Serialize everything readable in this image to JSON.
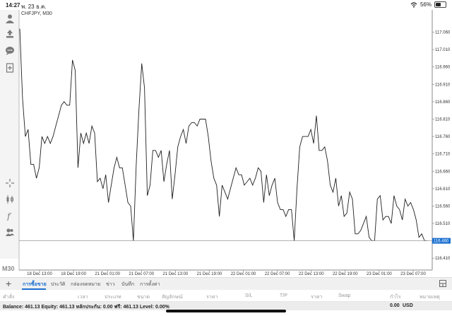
{
  "status_bar": {
    "time": "14:27",
    "date": "พ. 23 ธ.ค.",
    "battery": "56%",
    "battery_level": 0.56,
    "icons": [
      "wifi-icon",
      "battery-icon"
    ]
  },
  "toolbar": {
    "items": [
      "account-icon",
      "share-icon",
      "chat-icon",
      "new-order-icon",
      "crosshair-icon",
      "candlestick-icon",
      "indicator-icon",
      "objects-icon"
    ],
    "timeframe": "M30"
  },
  "chart": {
    "symbol": "CHFJPY, M30",
    "current_price": "116.460"
  },
  "chart_data": {
    "type": "line",
    "y_ticks": [
      "117.060",
      "117.010",
      "116.960",
      "116.910",
      "116.860",
      "116.810",
      "116.760",
      "116.710",
      "116.660",
      "116.610",
      "116.560",
      "116.510",
      "116.460",
      "116.410"
    ],
    "x_ticks": [
      "18 Dec 13:00",
      "18 Dec 19:00",
      "21 Dec 01:00",
      "21 Dec 07:00",
      "21 Dec 13:00",
      "21 Dec 19:00",
      "22 Dec 01:00",
      "22 Dec 07:00",
      "22 Dec 13:00",
      "22 Dec 19:00",
      "23 Dec 01:00",
      "23 Dec 07:00"
    ],
    "ylim": [
      116.38,
      117.12
    ],
    "close": [
      117.07,
      116.87,
      116.76,
      116.78,
      116.68,
      116.68,
      116.64,
      116.67,
      116.76,
      116.74,
      116.76,
      116.74,
      116.76,
      116.79,
      116.82,
      116.85,
      116.86,
      116.85,
      116.85,
      116.98,
      116.95,
      116.67,
      116.77,
      116.74,
      116.77,
      116.74,
      116.79,
      116.77,
      116.63,
      116.64,
      116.61,
      116.65,
      116.57,
      116.62,
      116.67,
      116.7,
      116.67,
      116.67,
      116.62,
      116.57,
      116.56,
      116.46,
      116.68,
      116.84,
      116.97,
      116.9,
      116.59,
      116.62,
      116.72,
      116.72,
      116.7,
      116.72,
      116.63,
      116.68,
      116.72,
      116.58,
      116.65,
      116.73,
      116.76,
      116.78,
      116.74,
      116.79,
      116.8,
      116.8,
      116.79,
      116.81,
      116.81,
      116.81,
      116.76,
      116.69,
      116.64,
      116.62,
      116.53,
      116.62,
      116.6,
      116.58,
      116.61,
      116.64,
      116.67,
      116.65,
      116.65,
      116.62,
      116.63,
      116.64,
      116.62,
      116.64,
      116.67,
      116.66,
      116.57,
      116.65,
      116.59,
      116.62,
      116.64,
      116.57,
      116.55,
      116.55,
      116.53,
      116.55,
      116.55,
      116.46,
      116.61,
      116.73,
      116.76,
      116.76,
      116.76,
      116.78,
      116.74,
      116.82,
      116.72,
      116.72,
      116.73,
      116.69,
      116.62,
      116.6,
      116.64,
      116.56,
      116.59,
      116.53,
      116.54,
      116.6,
      116.58,
      116.48,
      116.48,
      116.49,
      116.51,
      116.53,
      116.47,
      116.46,
      116.46,
      116.58,
      116.59,
      116.52,
      116.53,
      116.53,
      116.51,
      116.59,
      116.56,
      116.55,
      116.52,
      116.58,
      116.56,
      116.57,
      116.55,
      116.52,
      116.47,
      116.48,
      116.46,
      116.46
    ]
  },
  "tabs": [
    {
      "label": "การซื้อขาย",
      "active": true
    },
    {
      "label": "ประวัติ",
      "active": false
    },
    {
      "label": "กล่องจดหมาย",
      "active": false
    },
    {
      "label": "ข่าว",
      "active": false
    },
    {
      "label": "บันทึก",
      "active": false
    },
    {
      "label": "การตั้งค่า",
      "active": false
    }
  ],
  "columns": [
    "คำสั่ง",
    "เวลา",
    "ประเภท",
    "ขนาด",
    "สัญลักษณ์",
    "ราคา",
    "S/L",
    "T/P",
    "ราคา",
    "Swap",
    "กำไร",
    "หมายเหตุ"
  ],
  "account": {
    "summary": "Balance: 461.13 Equity: 461.13 หลักประกัน: 0.00 ฟรี: 461.13 Level: 0.00%",
    "profit": "0.00",
    "currency": "USD"
  },
  "colors": {
    "accent": "#1a6fd0",
    "price_line": "#1f1f1f",
    "price_tag": "#1a6fd0"
  }
}
